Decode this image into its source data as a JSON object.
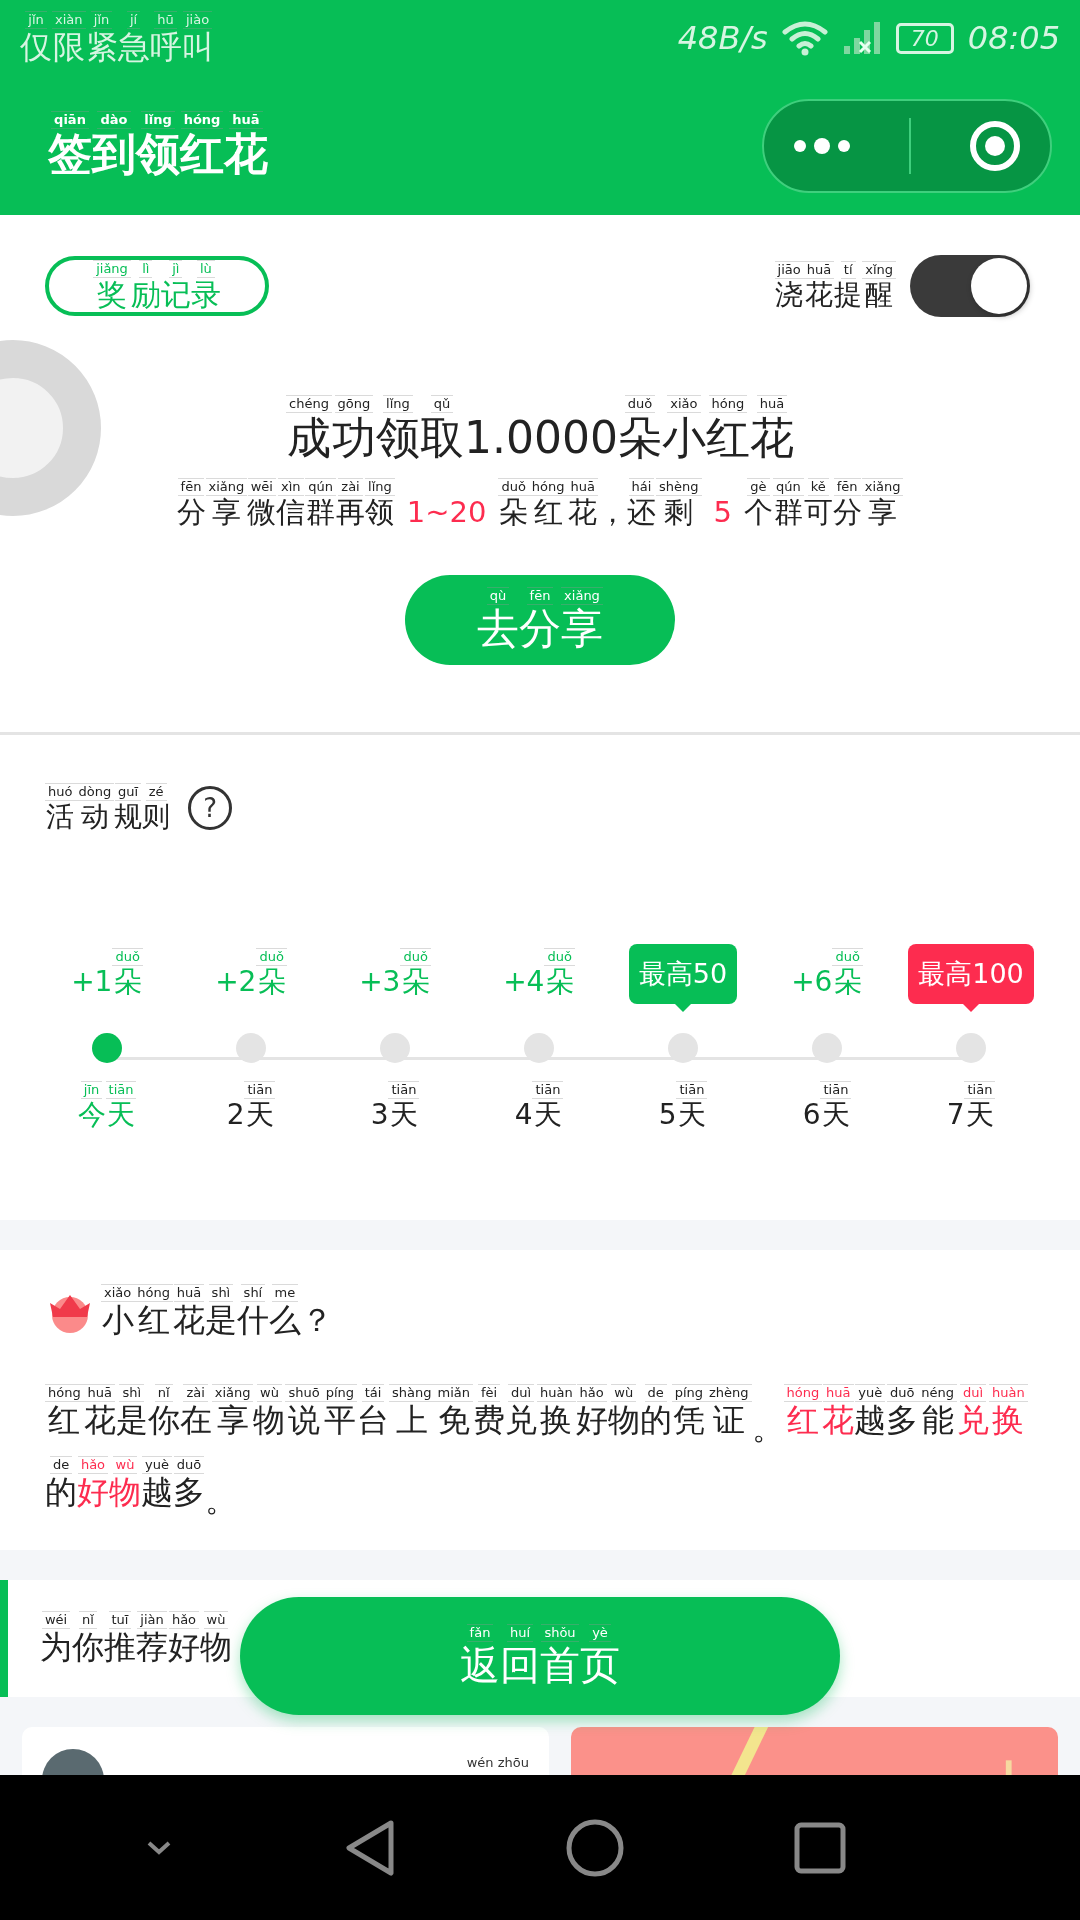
{
  "status_bar": {
    "carrier": [
      {
        "py": "jǐn",
        "t": "仅"
      },
      {
        "py": "xiàn",
        "t": "限"
      },
      {
        "py": "jǐn",
        "t": "紧"
      },
      {
        "py": "jí",
        "t": "急"
      },
      {
        "py": "hū",
        "t": "呼"
      },
      {
        "py": "jiào",
        "t": "叫"
      }
    ],
    "speed": "48B/s",
    "battery": "70",
    "time": "08:05"
  },
  "header": {
    "title": [
      {
        "py": "qiān",
        "t": "签"
      },
      {
        "py": "dào",
        "t": "到"
      },
      {
        "py": "lǐng",
        "t": "领"
      },
      {
        "py": "hóng",
        "t": "红"
      },
      {
        "py": "huā",
        "t": "花"
      }
    ]
  },
  "top": {
    "records_button": [
      {
        "py": "jiǎng",
        "t": "奖"
      },
      {
        "py": "lì",
        "t": "励"
      },
      {
        "py": "jì",
        "t": "记"
      },
      {
        "py": "lù",
        "t": "录"
      }
    ],
    "reminder": {
      "label": [
        {
          "py": "jiāo",
          "t": "浇"
        },
        {
          "py": "huā",
          "t": "花"
        },
        {
          "py": "tí",
          "t": "提"
        },
        {
          "py": "xǐng",
          "t": "醒"
        }
      ],
      "on": true
    },
    "headline": [
      {
        "py": "chéng",
        "t": "成"
      },
      {
        "py": "gōng",
        "t": "功"
      },
      {
        "py": "lǐng",
        "t": "领"
      },
      {
        "py": "qǔ",
        "t": "取"
      },
      {
        "t": "1.0000"
      },
      {
        "py": "duǒ",
        "t": "朵"
      },
      {
        "py": "xiǎo",
        "t": "小"
      },
      {
        "py": "hóng",
        "t": "红"
      },
      {
        "py": "huā",
        "t": "花"
      }
    ],
    "subline": [
      {
        "py": "fēn",
        "t": "分"
      },
      {
        "py": "xiǎng",
        "t": "享"
      },
      {
        "py": "wēi",
        "t": "微"
      },
      {
        "py": "xìn",
        "t": "信"
      },
      {
        "py": "qún",
        "t": "群"
      },
      {
        "py": "zài",
        "t": "再"
      },
      {
        "py": "lǐng",
        "t": "领"
      },
      {
        "t": "1~20",
        "hl": true
      },
      {
        "py": "duǒ",
        "t": "朵"
      },
      {
        "py": "hóng",
        "t": "红"
      },
      {
        "py": "huā",
        "t": "花"
      },
      {
        "t": "，"
      },
      {
        "py": "hái",
        "t": "还"
      },
      {
        "py": "shèng",
        "t": "剩"
      },
      {
        "t": "5",
        "hl": true
      },
      {
        "py": "gè",
        "t": "个"
      },
      {
        "py": "qún",
        "t": "群"
      },
      {
        "py": "kě",
        "t": "可"
      },
      {
        "py": "fēn",
        "t": "分"
      },
      {
        "py": "xiǎng",
        "t": "享"
      }
    ],
    "share_button": [
      {
        "py": "qù",
        "t": "去"
      },
      {
        "py": "fēn",
        "t": "分"
      },
      {
        "py": "xiǎng",
        "t": "享"
      }
    ]
  },
  "rules": {
    "title": [
      {
        "py": "huó",
        "t": "活"
      },
      {
        "py": "dòng",
        "t": "动"
      },
      {
        "py": "guī",
        "t": "规"
      },
      {
        "py": "zé",
        "t": "则"
      }
    ],
    "help": "?",
    "days": [
      {
        "kind": "plain",
        "reward": [
          {
            "t": "+1"
          },
          {
            "py": "duǒ",
            "t": "朵"
          }
        ],
        "day": [
          {
            "py": "jīn",
            "t": "今"
          },
          {
            "py": "tiān",
            "t": "天"
          }
        ],
        "selected": true
      },
      {
        "kind": "plain",
        "reward": [
          {
            "t": "+2"
          },
          {
            "py": "duǒ",
            "t": "朵"
          }
        ],
        "day": [
          {
            "t": "2"
          },
          {
            "py": "tiān",
            "t": "天"
          }
        ],
        "selected": false
      },
      {
        "kind": "plain",
        "reward": [
          {
            "t": "+3"
          },
          {
            "py": "duǒ",
            "t": "朵"
          }
        ],
        "day": [
          {
            "t": "3"
          },
          {
            "py": "tiān",
            "t": "天"
          }
        ],
        "selected": false
      },
      {
        "kind": "plain",
        "reward": [
          {
            "t": "+4"
          },
          {
            "py": "duǒ",
            "t": "朵"
          }
        ],
        "day": [
          {
            "t": "4"
          },
          {
            "py": "tiān",
            "t": "天"
          }
        ],
        "selected": false
      },
      {
        "kind": "bubble",
        "badge": "最高50",
        "color": "#07be56",
        "day": [
          {
            "t": "5"
          },
          {
            "py": "tiān",
            "t": "天"
          }
        ],
        "selected": false
      },
      {
        "kind": "plain",
        "reward": [
          {
            "t": "+6"
          },
          {
            "py": "duǒ",
            "t": "朵"
          }
        ],
        "day": [
          {
            "t": "6"
          },
          {
            "py": "tiān",
            "t": "天"
          }
        ],
        "selected": false
      },
      {
        "kind": "bubble",
        "badge": "最高100",
        "color": "#fd2c4f",
        "day": [
          {
            "t": "7"
          },
          {
            "py": "tiān",
            "t": "天"
          }
        ],
        "selected": false
      }
    ]
  },
  "about": {
    "title": [
      {
        "py": "xiǎo",
        "t": "小"
      },
      {
        "py": "hóng",
        "t": "红"
      },
      {
        "py": "huā",
        "t": "花"
      },
      {
        "py": "shì",
        "t": "是"
      },
      {
        "py": "shí",
        "t": "什"
      },
      {
        "py": "me",
        "t": "么"
      },
      {
        "t": "？"
      }
    ],
    "text": [
      {
        "py": "hóng",
        "t": "红"
      },
      {
        "py": "huā",
        "t": "花"
      },
      {
        "py": "shì",
        "t": "是"
      },
      {
        "py": "nǐ",
        "t": "你"
      },
      {
        "py": "zài",
        "t": "在"
      },
      {
        "py": "xiǎng",
        "t": "享"
      },
      {
        "py": "wù",
        "t": "物"
      },
      {
        "py": "shuō",
        "t": "说"
      },
      {
        "py": "píng",
        "t": "平"
      },
      {
        "py": "tái",
        "t": "台"
      },
      {
        "py": "shàng",
        "t": "上"
      },
      {
        "py": "miǎn",
        "t": "免"
      },
      {
        "py": "fèi",
        "t": "费"
      },
      {
        "py": "duì",
        "t": "兑"
      },
      {
        "py": "huàn",
        "t": "换"
      },
      {
        "py": "hǎo",
        "t": "好"
      },
      {
        "py": "wù",
        "t": "物"
      },
      {
        "py": "de",
        "t": "的"
      },
      {
        "py": "píng",
        "t": "凭"
      },
      {
        "py": "zhèng",
        "t": "证"
      },
      {
        "t": "。"
      },
      {
        "py": "hóng",
        "t": "红",
        "hl": true
      },
      {
        "py": "huā",
        "t": "花",
        "hl": true
      },
      {
        "py": "yuè",
        "t": "越"
      },
      {
        "py": "duō",
        "t": "多"
      },
      {
        "py": "néng",
        "t": "能"
      },
      {
        "py": "duì",
        "t": "兑",
        "hl": true
      },
      {
        "py": "huàn",
        "t": "换",
        "hl": true
      },
      {
        "py": "de",
        "t": "的"
      },
      {
        "py": "hǎo",
        "t": "好",
        "hl": true
      },
      {
        "py": "wù",
        "t": "物",
        "hl": true
      },
      {
        "py": "yuè",
        "t": "越"
      },
      {
        "py": "duō",
        "t": "多"
      },
      {
        "t": "。"
      }
    ]
  },
  "recommend": {
    "title": [
      {
        "py": "wéi",
        "t": "为"
      },
      {
        "py": "nǐ",
        "t": "你"
      },
      {
        "py": "tuī",
        "t": "推"
      },
      {
        "py": "jiàn",
        "t": "荐"
      },
      {
        "py": "hǎo",
        "t": "好"
      },
      {
        "py": "wù",
        "t": "物"
      }
    ],
    "home_button": [
      {
        "py": "fǎn",
        "t": "返"
      },
      {
        "py": "huí",
        "t": "回"
      },
      {
        "py": "shǒu",
        "t": "首"
      },
      {
        "py": "yè",
        "t": "页"
      }
    ],
    "card_note": "wén zhōu"
  }
}
